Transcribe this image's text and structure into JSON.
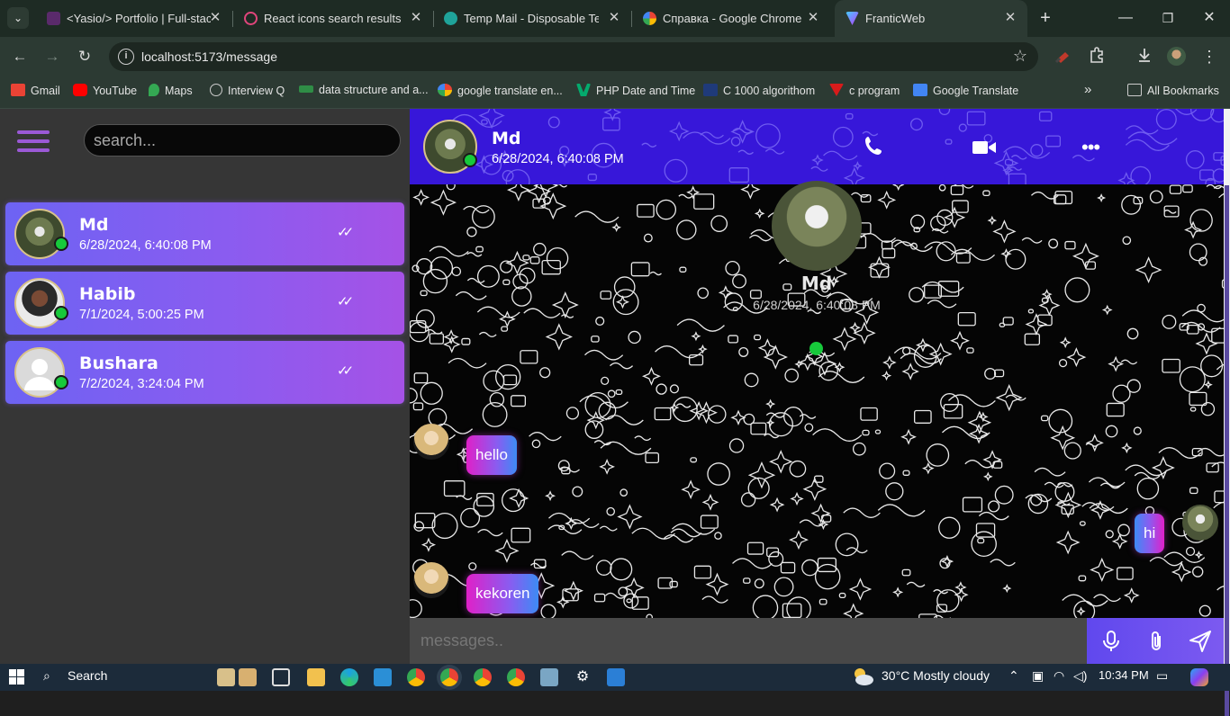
{
  "browser": {
    "tabs": [
      {
        "title": "<Yasio/> Portfolio | Full-stac",
        "icon": "portfolio-favicon",
        "active": false
      },
      {
        "title": "React icons search results",
        "icon": "react-favicon",
        "active": false
      },
      {
        "title": "Temp Mail - Disposable Tem",
        "icon": "tempmail-favicon",
        "active": false
      },
      {
        "title": "Справка - Google Chrome",
        "icon": "google-favicon",
        "active": false
      },
      {
        "title": "FranticWeb",
        "icon": "vite-favicon",
        "active": true
      }
    ],
    "url": "localhost:5173/message",
    "bookmarks": [
      {
        "label": "Gmail",
        "color": "#ea4335"
      },
      {
        "label": "YouTube",
        "color": "#ff0000"
      },
      {
        "label": "Maps",
        "color": "#34a853"
      },
      {
        "label": "Interview Q",
        "color": "#bdbdbd"
      },
      {
        "label": "data structure and a...",
        "color": "#2f8d46"
      },
      {
        "label": "google translate en...",
        "color": "#4285f4"
      },
      {
        "label": "PHP Date and Time",
        "color": "#04aa6d"
      },
      {
        "label": "C 1000  algorithom",
        "color": "#1f3a7a"
      },
      {
        "label": "c program",
        "color": "#d81b1b"
      },
      {
        "label": "Google Translate",
        "color": "#4285f4"
      }
    ],
    "all_bookmarks": "All Bookmarks"
  },
  "app": {
    "search_placeholder": "search...",
    "contacts": [
      {
        "name": "Md",
        "time": "6/28/2024, 6:40:08 PM",
        "online": true
      },
      {
        "name": "Habib",
        "time": "7/1/2024, 5:00:25 PM",
        "online": true
      },
      {
        "name": "Bushara",
        "time": "7/2/2024, 3:24:04 PM",
        "online": true
      }
    ],
    "chat": {
      "name": "Md",
      "time": "6/28/2024, 6:40:08 PM",
      "messages": [
        {
          "text": "hello",
          "side": "left"
        },
        {
          "text": "hi",
          "side": "right"
        },
        {
          "text": "kekoren",
          "side": "left"
        }
      ],
      "input_placeholder": "messages.."
    }
  },
  "taskbar": {
    "search": "Search",
    "weather": "30°C  Mostly cloudy",
    "clock": "10:34 PM"
  }
}
